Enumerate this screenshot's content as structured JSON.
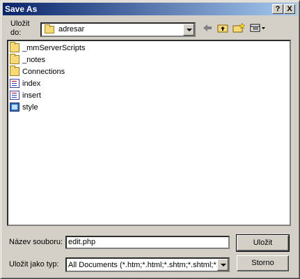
{
  "window": {
    "title": "Save As"
  },
  "titlebar_buttons": {
    "help": "?",
    "close": "X"
  },
  "lookin": {
    "label_line1": "Uložit",
    "label_line2": "do:",
    "value": "adresar"
  },
  "files": [
    {
      "name": "_mmServerScripts",
      "icon": "folder-icon"
    },
    {
      "name": "_notes",
      "icon": "folder-icon"
    },
    {
      "name": "Connections",
      "icon": "folder-icon"
    },
    {
      "name": "index",
      "icon": "php-file-icon"
    },
    {
      "name": "insert",
      "icon": "php-file-icon"
    },
    {
      "name": "style",
      "icon": "css-file-icon"
    }
  ],
  "filename": {
    "label": "Název souboru:",
    "value": "edit.php"
  },
  "filetype": {
    "label": "Uložit jako typ:",
    "value": "All Documents (*.htm;*.html;*.shtm;*.shtml;*.ht"
  },
  "buttons": {
    "save": "Uložit",
    "cancel": "Storno"
  }
}
